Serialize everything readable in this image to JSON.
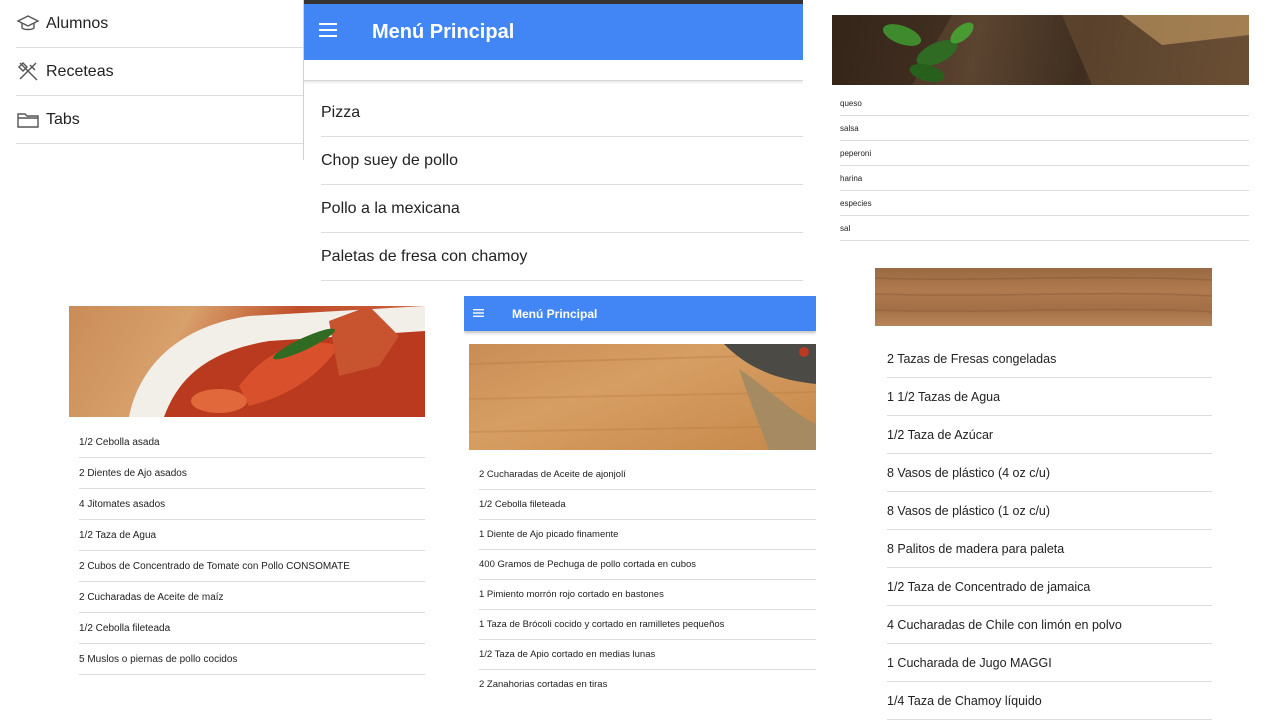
{
  "side_menu": {
    "items": [
      {
        "label": "Alumnos",
        "icon": "graduation-cap-icon"
      },
      {
        "label": "Receteas",
        "icon": "utensils-icon"
      },
      {
        "label": "Tabs",
        "icon": "folder-icon"
      }
    ]
  },
  "menu_principal": {
    "title": "Menú Principal",
    "recipes": [
      "Pizza",
      "Chop suey de pollo",
      "Pollo a la mexicana",
      "Paletas de fresa con chamoy"
    ]
  },
  "pizza": {
    "ingredients": [
      "queso",
      "salsa",
      "peperoni",
      "harina",
      "especies",
      "sal"
    ]
  },
  "pollo_mexicana": {
    "ingredients": [
      "1/2 Cebolla asada",
      "2 Dientes de Ajo asados",
      "4 Jitomates asados",
      "1/2 Taza de Agua",
      "2 Cubos de Concentrado de Tomate con Pollo CONSOMATE",
      "2 Cucharadas de Aceite de maíz",
      "1/2 Cebolla fileteada",
      "5 Muslos o piernas de pollo cocidos"
    ]
  },
  "chop_suey": {
    "title": "Menú Principal",
    "ingredients": [
      "2 Cucharadas de Aceite de ajonjolí",
      "1/2 Cebolla fileteada",
      "1 Diente de Ajo picado finamente",
      "400 Gramos de Pechuga de pollo cortada en cubos",
      "1 Pimiento morrón rojo cortado en bastones",
      "1 Taza de Brócoli cocido y cortado en ramilletes pequeños",
      "1/2 Taza de Apio cortado en medias lunas",
      "2 Zanahorias cortadas en tiras"
    ]
  },
  "paletas": {
    "ingredients": [
      "2 Tazas de Fresas congeladas",
      "1 1/2 Tazas de Agua",
      "1/2 Taza de Azúcar",
      "8 Vasos de plástico (4 oz c/u)",
      "8 Vasos de plástico (1 oz c/u)",
      "8 Palitos de madera para paleta",
      "1/2 Taza de Concentrado de jamaica",
      "4 Cucharadas de Chile con limón en polvo",
      "1 Cucharada de Jugo MAGGI",
      "1/4 Taza de Chamoy líquido"
    ]
  },
  "colors": {
    "toolbar": "#4286f5",
    "divider": "#dcdcdc"
  }
}
